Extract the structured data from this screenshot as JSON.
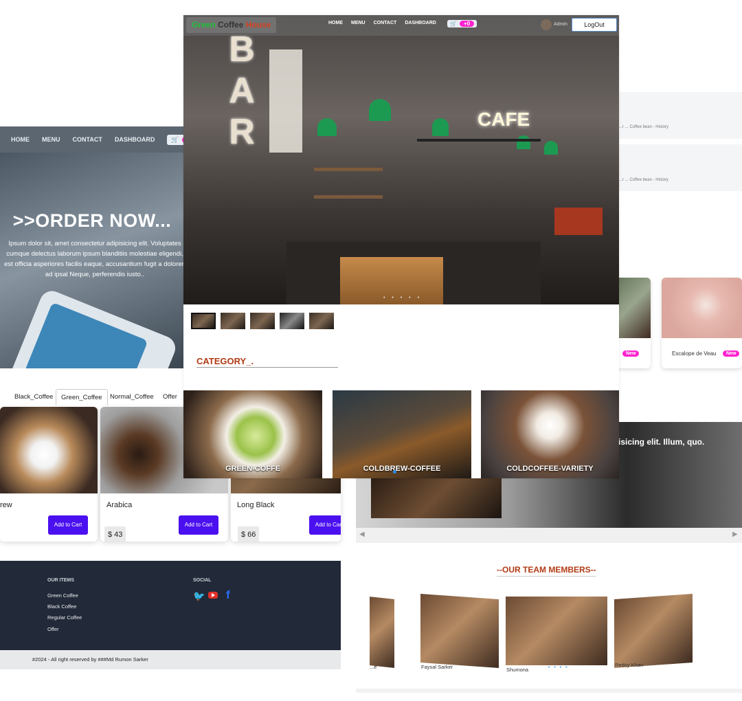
{
  "main": {
    "brand": {
      "word1": "Green",
      "word2": "Coffee",
      "word3": "House",
      "color1": "#1fbf3a",
      "color2": "#333333",
      "color3": "#d5401f"
    },
    "nav": [
      "HOME",
      "MENU",
      "CONTACT",
      "DASHBOARD"
    ],
    "cart_count": "+0",
    "user_label": "Admin",
    "logout_label": "LogOut",
    "category_heading": "CATEGORY_."
  },
  "left_shot": {
    "nav": [
      "HOME",
      "MENU",
      "CONTACT",
      "DASHBOARD"
    ],
    "cart_count": "+0",
    "title": ">>ORDER NOW...",
    "text": "Ipsum dolor sit, amet consectetur adipisicing elit. Voluptates cumque delectus laborum ipsum blanditiis molestiae eligendi, est officia asperiores facilis eaque, accusantium fugit a doloren ad ipsal Neque, perferendis iusto.."
  },
  "right_shot": {
    "crumb1": "...r ... Coffee bean - History",
    "crumb2": "...r ... Coffee bean - History",
    "food_card_title": "Escalope de Veau",
    "badge": "New",
    "banner_title": "isicing elit. Illum, quo."
  },
  "categories": [
    "GREEN-COFFE",
    "COLDBREW-COFFEE",
    "COLDCOFFEE-VARIETY"
  ],
  "tabs": [
    "Black_Coffee",
    "Green_Coffee",
    "Normal_Coffee",
    "Offer"
  ],
  "active_tab": "Green_Coffee",
  "products": [
    {
      "name": "rew",
      "price": ""
    },
    {
      "name": "Arabica",
      "price": "$ 43"
    },
    {
      "name": "Long Black",
      "price": "$ 66"
    }
  ],
  "add_to_cart": "Add to Cart",
  "footer": {
    "items_heading": "OUR ITEMS",
    "items": [
      "Green Coffee",
      "Black Coffee",
      "Regular Coffee",
      "Offer"
    ],
    "social_heading": "SOCIAL",
    "copyright": "#2024 - All right reserved by ###Md Rumon Sarker"
  },
  "team": {
    "heading": "--OUR TEAM MEMBERS--",
    "members": [
      "...e",
      "Faysal Sarker",
      "Shumona",
      "Redoy Khan"
    ]
  },
  "colors": {
    "accent": "#4b10f0",
    "badge": "#ff20cf",
    "heading": "#b13a14",
    "footer": "#222938"
  }
}
